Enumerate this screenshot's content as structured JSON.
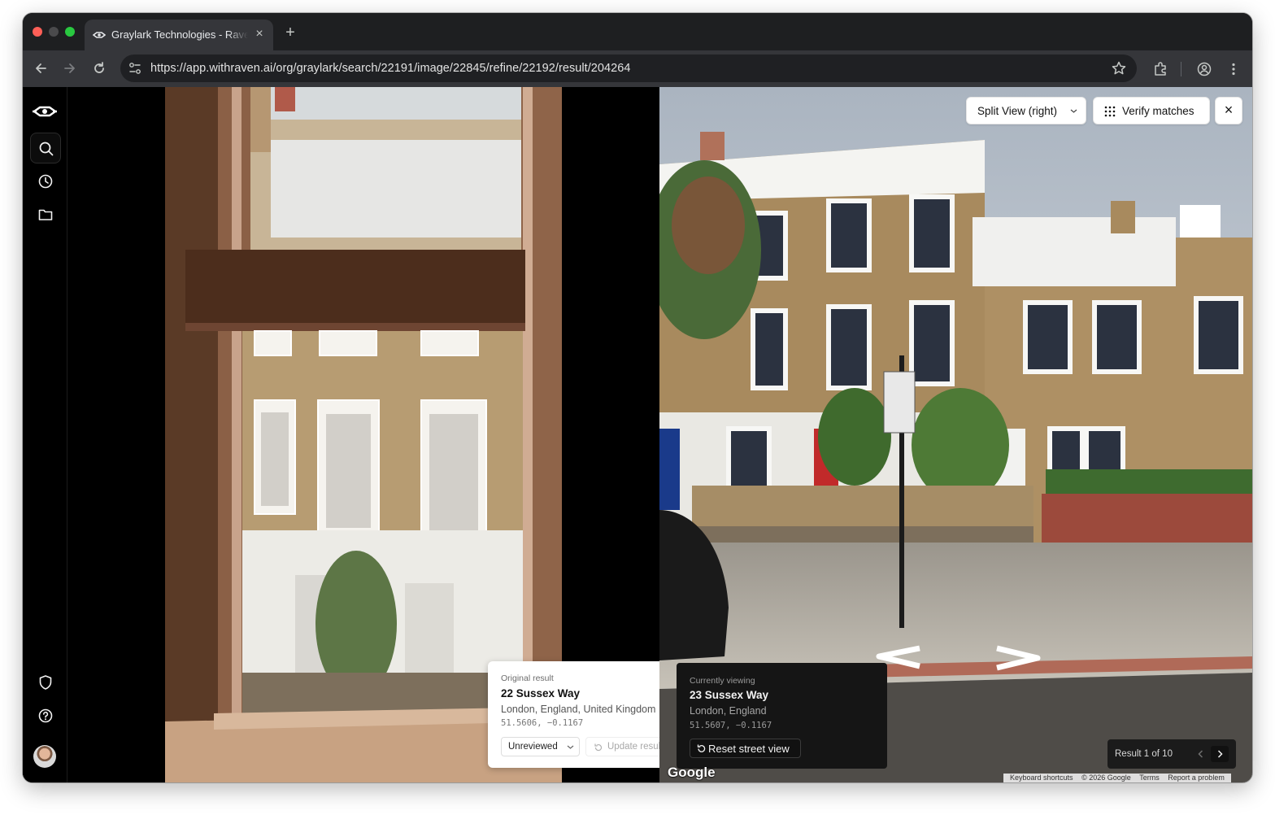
{
  "browser": {
    "tab_title": "Graylark Technologies - Raven",
    "new_tab": "+",
    "tab_close": "×",
    "url": "https://app.withraven.ai/org/graylark/search/22191/image/22845/refine/22192/result/204264"
  },
  "rail": {
    "items": [
      "raven-logo-icon",
      "search-icon",
      "history-icon",
      "folder-icon",
      "shield-icon",
      "help-icon"
    ]
  },
  "toolbar": {
    "split_view": "Split View (right)",
    "verify": "Verify matches",
    "close": "×"
  },
  "original": {
    "label": "Original result",
    "title": "22 Sussex Way",
    "location": "London, England, United Kingdom",
    "coords": "51.5606, −0.1167",
    "status": "Unreviewed",
    "update": "Update result"
  },
  "current": {
    "label": "Currently viewing",
    "title": "23 Sussex Way",
    "location": "London, England",
    "coords": "51.5607, −0.1167",
    "reset": "Reset street view"
  },
  "results": {
    "text": "Result 1 of 10"
  },
  "map_footer": {
    "logo": "Google",
    "keyboard": "Keyboard shortcuts",
    "copyright": "© 2026 Google",
    "terms": "Terms",
    "report": "Report a problem"
  },
  "colors": {
    "chrome_bg": "#1e1f21",
    "toolbar_bg": "#35363a",
    "rail_bg": "#000000",
    "card_light": "#ffffff",
    "card_dark": "#151515",
    "brick": "#a88a5e"
  }
}
